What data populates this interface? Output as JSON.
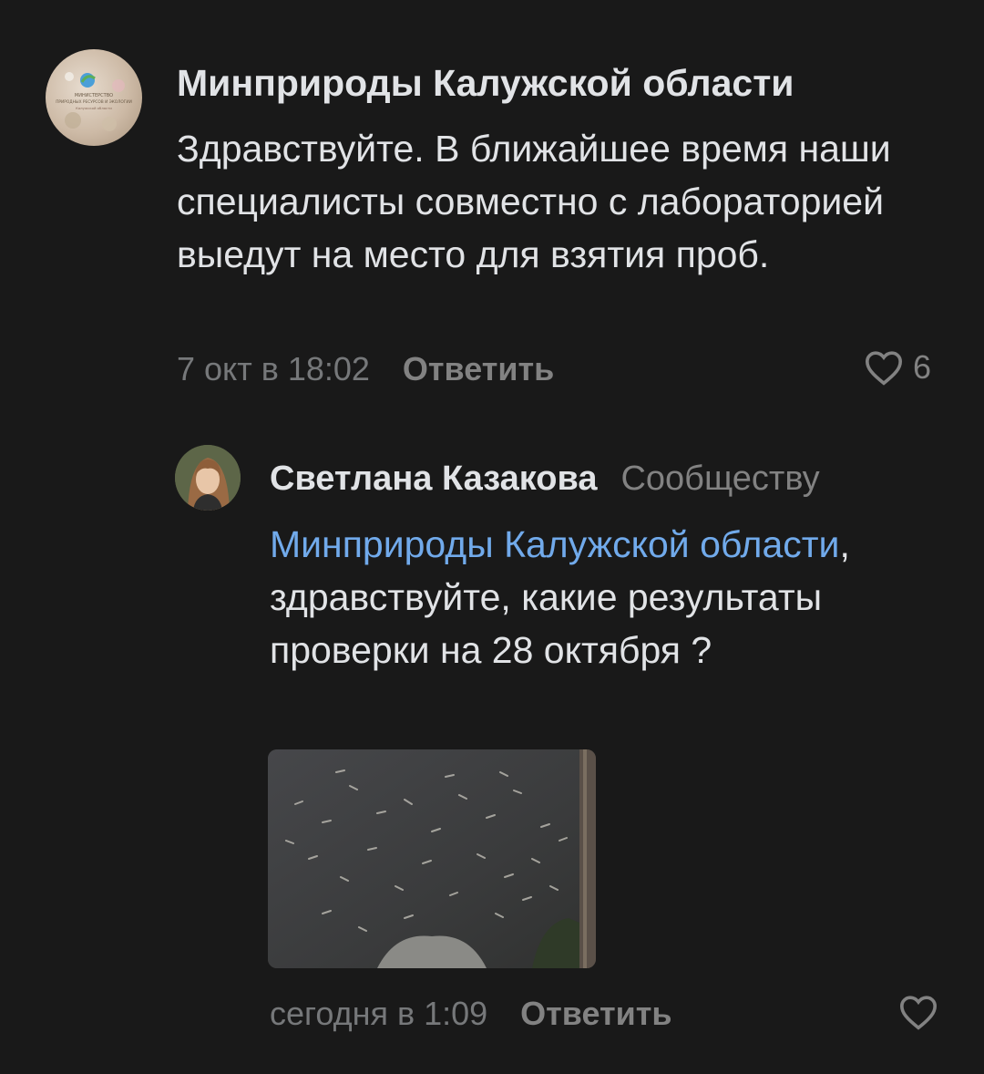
{
  "comments": [
    {
      "author": "Минприроды Калужской области",
      "avatar_text": [
        "МИНИСТЕРСТВО",
        "ПРИРОДНЫХ РЕСУРСОВ И ЭКОЛОГИИ",
        "Калужской области"
      ],
      "text": "Здравствуйте. В ближайшее время наши специалисты совместно с лабораторией выедут на место для взятия проб.",
      "time": "7 окт в 18:02",
      "reply_label": "Ответить",
      "likes": "6"
    },
    {
      "author": "Светлана Казакова",
      "target": "Сообществу",
      "mention": "Минприроды Калужской области",
      "text": ", здравствуйте, какие результаты проверки на 28 октября ?",
      "photo_alt": "dead-fish-on-water-photo",
      "time": "сегодня в 1:09",
      "reply_label": "Ответить"
    }
  ],
  "colors": {
    "background": "#191919",
    "text": "#e1e3e6",
    "secondary": "#76787a",
    "link": "#71aaeb"
  }
}
